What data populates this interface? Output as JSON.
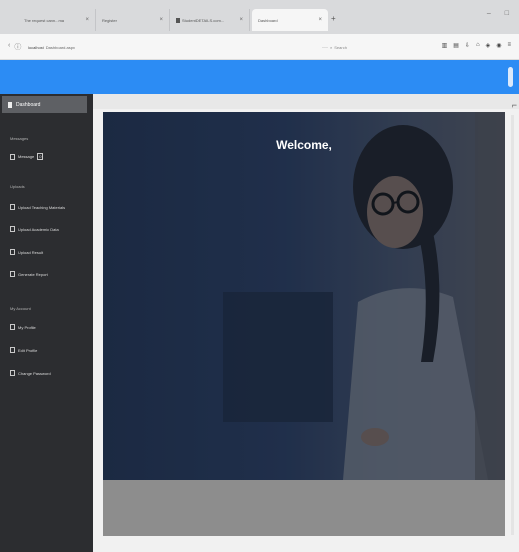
{
  "browser": {
    "tabs": [
      {
        "label": "The request cann...ma",
        "active": false
      },
      {
        "label": "Register",
        "active": false
      },
      {
        "label": "StudentDETAILS.com...",
        "active": false
      },
      {
        "label": "Dashboard",
        "active": true
      }
    ],
    "new_tab_icon": "plus",
    "window_controls": [
      "–",
      "□"
    ],
    "url_host": "localhost",
    "url_path": "Dashboard.aspx",
    "url_more": "···",
    "search_placeholder": "Search",
    "toolbar_icons": [
      "library-icon",
      "sidebar-icon",
      "download-icon",
      "home-icon",
      "shield-icon",
      "extension-icon",
      "menu-icon"
    ]
  },
  "topbar": {
    "color": "#2c8cf4"
  },
  "sidebar": {
    "active_label": "Dashboard",
    "sections": [
      {
        "heading": "Messages",
        "items": [
          {
            "label": "Message",
            "badge": "0"
          }
        ]
      },
      {
        "heading": "Uploads",
        "items": [
          {
            "label": "Upload Teaching Materials"
          },
          {
            "label": "Upload Academic Data"
          },
          {
            "label": "Upload Result"
          },
          {
            "label": "Generate Report"
          }
        ]
      },
      {
        "heading": "My Account",
        "items": [
          {
            "label": "My Profile"
          },
          {
            "label": "Edit Profile"
          },
          {
            "label": "Change Password"
          }
        ]
      }
    ]
  },
  "hero": {
    "welcome_text": "Welcome,"
  }
}
